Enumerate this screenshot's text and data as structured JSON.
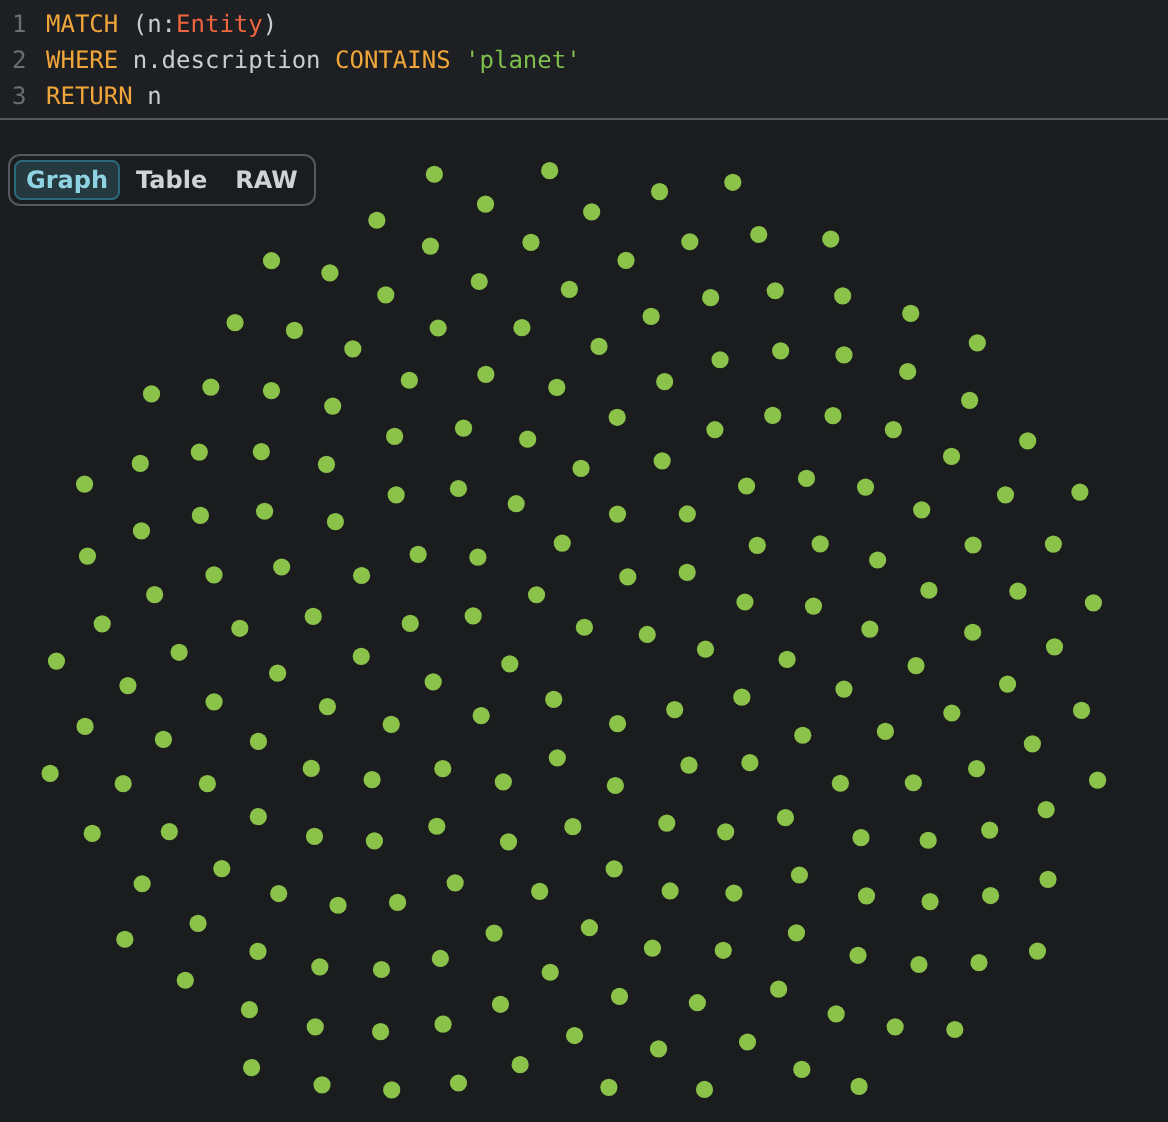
{
  "editor": {
    "lines": [
      {
        "number": "1",
        "tokens": [
          {
            "kind": "keyword",
            "text": "MATCH"
          },
          {
            "kind": "plain",
            "text": " ("
          },
          {
            "kind": "plain",
            "text": "n:"
          },
          {
            "kind": "label",
            "text": "Entity"
          },
          {
            "kind": "plain",
            "text": ")"
          }
        ]
      },
      {
        "number": "2",
        "tokens": [
          {
            "kind": "keyword",
            "text": "WHERE"
          },
          {
            "kind": "plain",
            "text": " n.description "
          },
          {
            "kind": "keyword",
            "text": "CONTAINS"
          },
          {
            "kind": "string",
            "text": " 'planet'"
          }
        ]
      },
      {
        "number": "3",
        "tokens": [
          {
            "kind": "keyword",
            "text": "RETURN"
          },
          {
            "kind": "plain",
            "text": " n"
          }
        ]
      }
    ]
  },
  "view_tabs": [
    {
      "label": "Graph",
      "selected": true
    },
    {
      "label": "Table",
      "selected": false
    },
    {
      "label": "RAW",
      "selected": false
    }
  ],
  "graph": {
    "kind": "node-cloud"
  }
}
